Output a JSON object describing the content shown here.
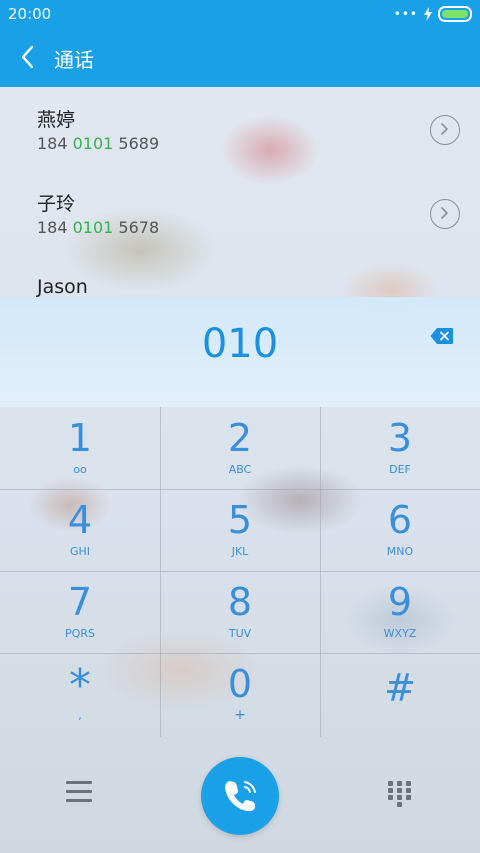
{
  "status_bar": {
    "time": "20:00",
    "signal_dots": "•••"
  },
  "header": {
    "title": "通话"
  },
  "contacts": [
    {
      "name": "燕婷",
      "number_prefix": "184 ",
      "number_match": "0101",
      "number_suffix": " 5689"
    },
    {
      "name": "子玲",
      "number_prefix": "184 ",
      "number_match": "0101",
      "number_suffix": " 5678"
    },
    {
      "name": "Jason"
    }
  ],
  "dial_input": {
    "value": "010"
  },
  "keypad": {
    "keys": [
      {
        "digit": "1",
        "letters": "oo"
      },
      {
        "digit": "2",
        "letters": "ABC"
      },
      {
        "digit": "3",
        "letters": "DEF"
      },
      {
        "digit": "4",
        "letters": "GHI"
      },
      {
        "digit": "5",
        "letters": "JKL"
      },
      {
        "digit": "6",
        "letters": "MNO"
      },
      {
        "digit": "7",
        "letters": "PQRS"
      },
      {
        "digit": "8",
        "letters": "TUV"
      },
      {
        "digit": "9",
        "letters": "WXYZ"
      },
      {
        "digit": "*",
        "letters": ","
      },
      {
        "digit": "0",
        "letters": "+"
      },
      {
        "digit": "#",
        "letters": ""
      }
    ]
  },
  "icons": {
    "back": "back-arrow-icon",
    "info": "chevron-right-icon",
    "backspace": "backspace-icon",
    "menu": "menu-icon",
    "call": "phone-icon",
    "dialpad": "dialpad-icon"
  },
  "colors": {
    "accent": "#1aa0e6",
    "digit": "#3a8fd8",
    "match_highlight": "#35b24a",
    "battery": "#7ee26a"
  }
}
